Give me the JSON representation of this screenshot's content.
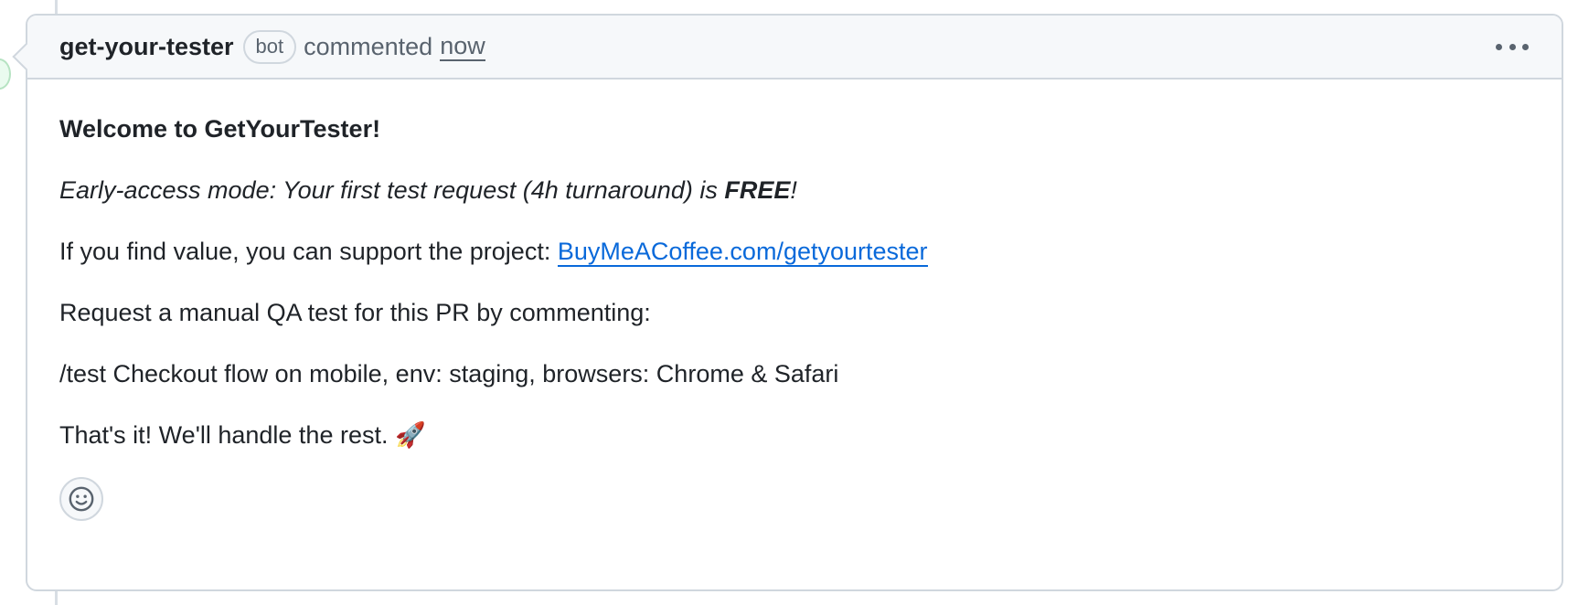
{
  "header": {
    "author": "get-your-tester",
    "badge": "bot",
    "action": "commented",
    "time": "now"
  },
  "body": {
    "welcome": "Welcome to GetYourTester!",
    "early_access_prefix": "Early-access mode: Your first test request (4h turnaround) is ",
    "early_access_bold": "FREE",
    "early_access_suffix": "!",
    "support_text": "If you find value, you can support the project: ",
    "support_link": "BuyMeACoffee.com/getyourtester",
    "request_text": "Request a manual QA test for this PR by commenting:",
    "command": "/test Checkout flow on mobile, env: staging, browsers: Chrome & Safari",
    "closing_text": "That's it! We'll handle the rest. ",
    "closing_emoji": "🚀"
  },
  "icons": {
    "menu": "kebab-horizontal-icon",
    "reaction": "smiley-icon"
  },
  "colors": {
    "link": "#0969da",
    "muted": "#59636e",
    "border": "#d0d7de",
    "header_bg": "#f6f8fa"
  }
}
